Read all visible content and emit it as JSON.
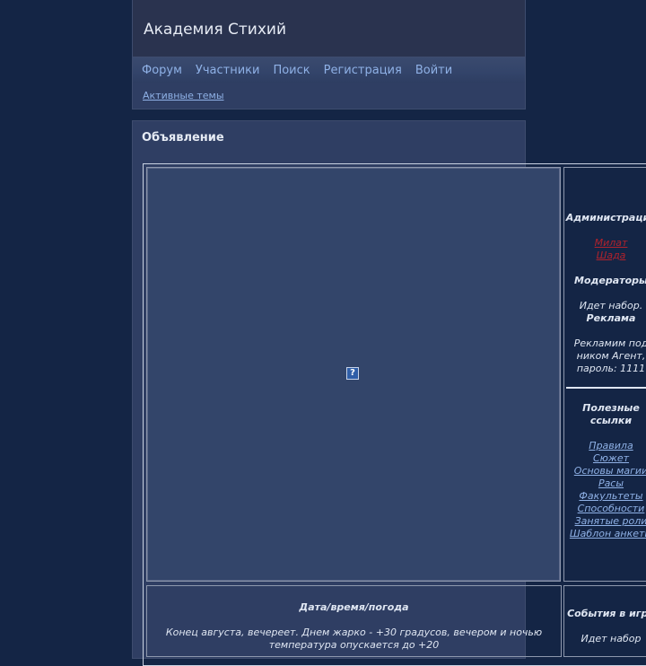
{
  "header": {
    "title": "Академия Стихий"
  },
  "nav": {
    "items": [
      "Форум",
      "Участники",
      "Поиск",
      "Регистрация",
      "Войти"
    ]
  },
  "subnav": {
    "active_topics": "Активные темы"
  },
  "announcement": {
    "title": "Объявление",
    "broken_image_icon": "broken-image-icon",
    "sidebar": {
      "admin_heading": "Администрация",
      "admins": [
        "Милат",
        "Шада"
      ],
      "moderators_heading": "Модераторы",
      "moderators_text": "Идет набор.",
      "ads_heading": "Реклама",
      "ads_line1": "Рекламим под",
      "ads_line2": "ником Агент,",
      "ads_line3": "пароль: 1111",
      "links_heading_1": "Полезные",
      "links_heading_2": "ссылки",
      "links": [
        "Правила",
        "Сюжет",
        "Основы магии",
        "Расы",
        "Факультеты",
        "Способности",
        "Занятые роли",
        "Шаблон анкеты"
      ]
    },
    "bottom": {
      "heading": "Дата/время/погода",
      "line1": "Конец августа, вечереет. Днем жарко - +30 градусов, вечером и ночью",
      "line2": "температура опускается до +20",
      "events_heading": "События в игре",
      "events_text": "Идет набор"
    }
  },
  "colors": {
    "background": "#142545",
    "panel": "#2f3e63",
    "link": "#8fb1e6",
    "admin_link": "#b0222c"
  }
}
